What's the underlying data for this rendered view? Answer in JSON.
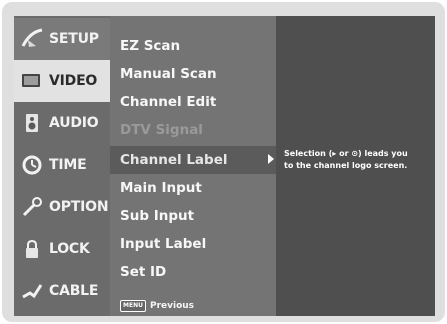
{
  "sidebar": {
    "items": [
      {
        "label": "SETUP",
        "icon": "satellite-dish-icon",
        "state": "selected"
      },
      {
        "label": "VIDEO",
        "icon": "tv-icon",
        "state": "highlight"
      },
      {
        "label": "AUDIO",
        "icon": "speaker-icon",
        "state": ""
      },
      {
        "label": "TIME",
        "icon": "clock-icon",
        "state": ""
      },
      {
        "label": "OPTION",
        "icon": "wrench-icon",
        "state": ""
      },
      {
        "label": "LOCK",
        "icon": "padlock-icon",
        "state": ""
      },
      {
        "label": "CABLE",
        "icon": "cable-icon",
        "state": ""
      }
    ]
  },
  "menu": {
    "items": [
      {
        "label": "EZ Scan",
        "state": ""
      },
      {
        "label": "Manual Scan",
        "state": ""
      },
      {
        "label": "Channel Edit",
        "state": ""
      },
      {
        "label": "DTV Signal",
        "state": "disabled"
      },
      {
        "label": "Channel Label",
        "state": "active"
      },
      {
        "label": "Main Input",
        "state": ""
      },
      {
        "label": "Sub Input",
        "state": ""
      },
      {
        "label": "Input Label",
        "state": ""
      },
      {
        "label": "Set ID",
        "state": ""
      }
    ],
    "hint": {
      "key_label": "MENU",
      "text": "Previous"
    }
  },
  "info": {
    "text": "Selection (▸ or ⊙) leads you\nto the channel logo screen."
  },
  "colors": {
    "frame": "#dfdfdf",
    "sidebar": "#6b6b6b",
    "menu": "#747474",
    "info_panel": "#4f4f4f",
    "active_row": "#5b5b5b"
  }
}
